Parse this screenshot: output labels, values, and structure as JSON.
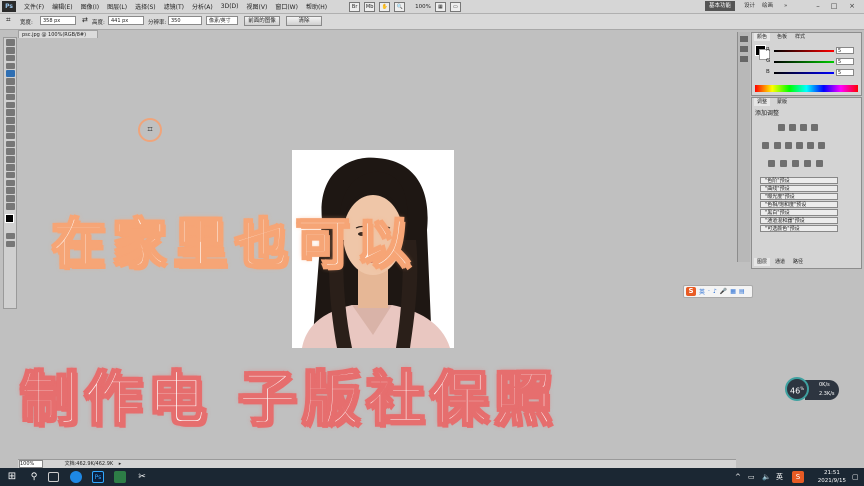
{
  "menubar": {
    "logo": "Ps",
    "items": [
      "文件(F)",
      "编辑(E)",
      "图像(I)",
      "图层(L)",
      "选择(S)",
      "滤镜(T)",
      "分析(A)",
      "3D(D)",
      "视图(V)",
      "窗口(W)",
      "帮助(H)"
    ],
    "zoom": "100%",
    "workspace": "基本功能",
    "links": [
      "设计",
      "绘画"
    ]
  },
  "options": {
    "width_label": "宽度:",
    "width_value": "358 px",
    "height_label": "高度:",
    "height_value": "441 px",
    "resolution_label": "分辨率:",
    "resolution_value": "350",
    "unit_value": "像素/英寸",
    "front_image_button": "前面的图像",
    "clear_button": "清除"
  },
  "document": {
    "tab_title": "psc.jpg @ 100%(RGB/8#)"
  },
  "captions": {
    "line1": "在家里也可以",
    "line2": "制作电 子版社保照"
  },
  "color_panel": {
    "tabs": [
      "颜色",
      "色板",
      "样式"
    ],
    "channels": [
      {
        "name": "R",
        "value": "5",
        "color": "#d02020"
      },
      {
        "name": "G",
        "value": "5",
        "color": "#20a020"
      },
      {
        "name": "B",
        "value": "5",
        "color": "#2040d0"
      }
    ]
  },
  "adjustments_panel": {
    "tabs": [
      "调整",
      "蒙版"
    ],
    "title": "添加调整",
    "presets": [
      "\"色阶\"预设",
      "\"曲线\"预设",
      "\"曝光度\"预设",
      "\"色相/饱和度\"预设",
      "\"黑白\"预设",
      "\"通道混和器\"预设",
      "\"可选颜色\"预设"
    ],
    "bottom_tabs": [
      "图层",
      "通道",
      "路径"
    ]
  },
  "ime": {
    "logo": "S",
    "items": [
      "英",
      "·",
      "♪",
      "🎤",
      "▦",
      "▤"
    ]
  },
  "speed_widget": {
    "percent": "46",
    "percent_unit": "%",
    "up": "0K/s",
    "down": "2.3K/s"
  },
  "status": {
    "zoom": "100%",
    "doc": "文档:462.9K/462.9K"
  },
  "taskbar": {
    "time": "21:51",
    "date": "2021/9/15",
    "accent": "#1b2733"
  }
}
